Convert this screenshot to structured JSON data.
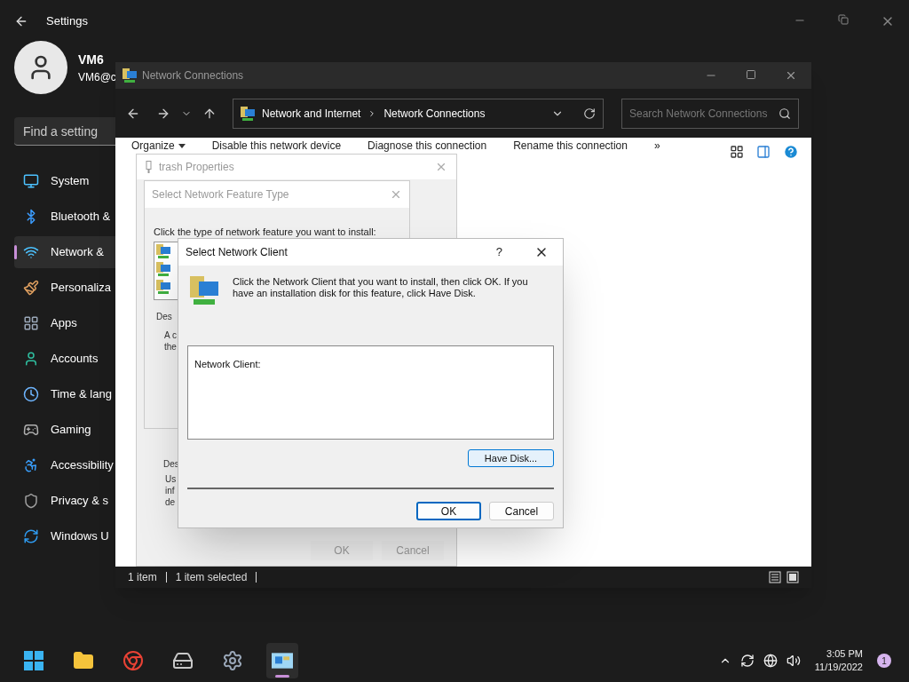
{
  "settings": {
    "title": "Settings",
    "user": {
      "name": "VM6",
      "email": "VM6@c"
    },
    "search": {
      "placeholder": "Find a setting"
    },
    "nav": [
      {
        "label": "System",
        "kind": "system",
        "selected": false
      },
      {
        "label": "Bluetooth &",
        "kind": "bluetooth",
        "selected": false
      },
      {
        "label": "Network &",
        "kind": "network",
        "selected": true
      },
      {
        "label": "Personaliza",
        "kind": "brush",
        "selected": false
      },
      {
        "label": "Apps",
        "kind": "apps",
        "selected": false
      },
      {
        "label": "Accounts",
        "kind": "accounts",
        "selected": false
      },
      {
        "label": "Time & lang",
        "kind": "time",
        "selected": false
      },
      {
        "label": "Gaming",
        "kind": "gaming",
        "selected": false
      },
      {
        "label": "Accessibility",
        "kind": "accessibility",
        "selected": false
      },
      {
        "label": "Privacy & s",
        "kind": "privacy",
        "selected": false
      },
      {
        "label": "Windows U",
        "kind": "update",
        "selected": false
      }
    ]
  },
  "explorer": {
    "title": "Network Connections",
    "breadcrumb": [
      "Network and Internet",
      "Network Connections"
    ],
    "search": {
      "placeholder": "Search Network Connections"
    },
    "toolbar": [
      "Organize",
      "Disable this network device",
      "Diagnose this connection",
      "Rename this connection",
      "»"
    ],
    "status": [
      "1 item",
      "1 item selected"
    ]
  },
  "properties": {
    "title": "trash Properties",
    "description": {
      "label": "Des",
      "lines": [
        "Us",
        "inf",
        "de"
      ]
    },
    "buttons": [
      "OK",
      "Cancel"
    ]
  },
  "feature_type": {
    "title": "Select Network Feature Type",
    "prompt": "Click the type of network feature you want to install:",
    "description": {
      "label": "Des",
      "lines": [
        "A c",
        "the"
      ]
    }
  },
  "client_dialog": {
    "title": "Select Network Client",
    "help": "?",
    "description": "Click the Network Client that you want to install, then click OK. If you have an installation disk for this feature, click Have Disk.",
    "list_label": "Network Client:",
    "have_disk": "Have Disk...",
    "buttons": [
      {
        "label": "OK",
        "default": true
      },
      {
        "label": "Cancel",
        "default": false
      }
    ]
  },
  "taskbar": {
    "apps": [
      {
        "kind": "start",
        "active": false
      },
      {
        "kind": "folder",
        "active": false
      },
      {
        "kind": "browser",
        "active": false
      },
      {
        "kind": "disk",
        "active": false
      },
      {
        "kind": "gear",
        "active": false
      },
      {
        "kind": "network",
        "active": true
      }
    ],
    "time": "3:05 PM",
    "date": "11/19/2022",
    "badge": "1"
  }
}
